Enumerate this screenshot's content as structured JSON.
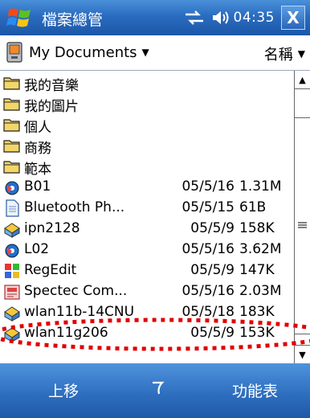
{
  "titlebar": {
    "title": "檔案總管",
    "clock": "04:35",
    "close_label": "X"
  },
  "folderbar": {
    "folder": "My Documents",
    "sort": "名稱"
  },
  "files": [
    {
      "name": "我的音樂",
      "date": "",
      "size": "",
      "icon": "folder-icon"
    },
    {
      "name": "我的圖片",
      "date": "",
      "size": "",
      "icon": "folder-icon"
    },
    {
      "name": "個人",
      "date": "",
      "size": "",
      "icon": "folder-icon"
    },
    {
      "name": "商務",
      "date": "",
      "size": "",
      "icon": "folder-icon"
    },
    {
      "name": "範本",
      "date": "",
      "size": "",
      "icon": "folder-icon"
    },
    {
      "name": "B01",
      "date": "05/5/16",
      "size": "1.31M",
      "icon": "media-file-icon"
    },
    {
      "name": "Bluetooth Ph...",
      "date": "05/5/15",
      "size": "61B",
      "icon": "document-icon"
    },
    {
      "name": "ipn2128",
      "date": "05/5/9",
      "size": "158K",
      "icon": "installer-icon"
    },
    {
      "name": "L02",
      "date": "05/5/16",
      "size": "3.62M",
      "icon": "media-file-icon"
    },
    {
      "name": "RegEdit",
      "date": "05/5/9",
      "size": "147K",
      "icon": "app-icon"
    },
    {
      "name": "Spectec Com...",
      "date": "05/5/16",
      "size": "2.03M",
      "icon": "installer-box-icon"
    },
    {
      "name": "wlan11b-14CNU",
      "date": "05/5/18",
      "size": "183K",
      "icon": "installer-icon"
    },
    {
      "name": "wlan11g206",
      "date": "05/5/9",
      "size": "153K",
      "icon": "installer-icon"
    }
  ],
  "menubar": {
    "left": "上移",
    "right": "功能表"
  },
  "colors": {
    "bar_blue": "#2a6cc0",
    "annotation_red": "#e00000"
  }
}
